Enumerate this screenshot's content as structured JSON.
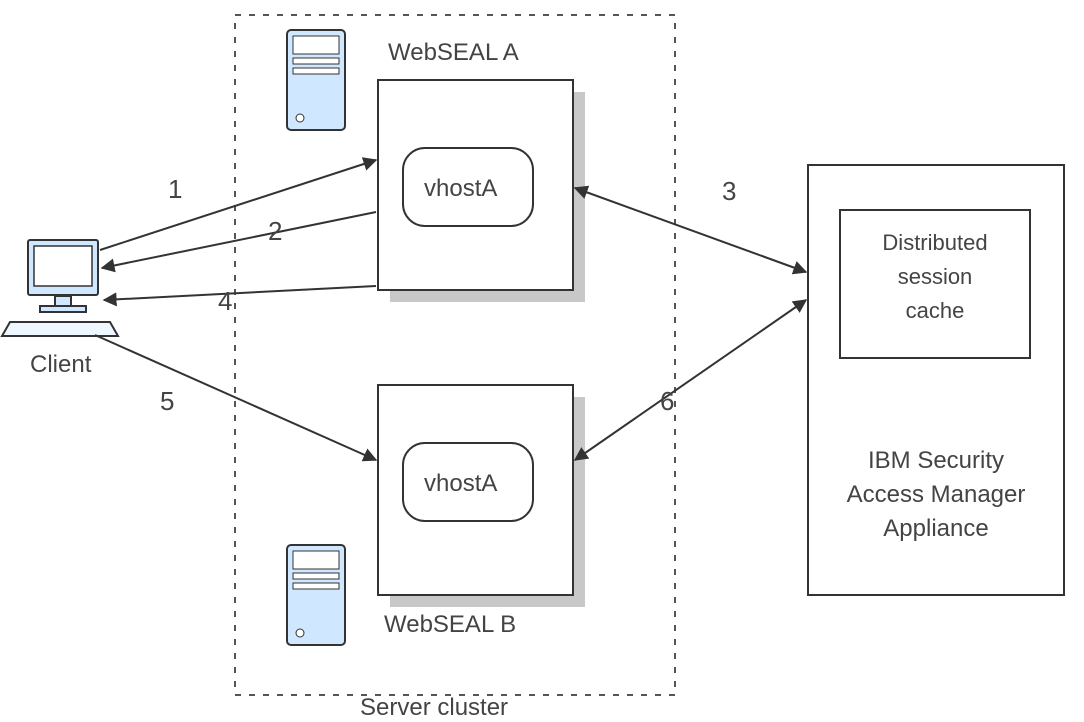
{
  "client_label": "Client",
  "cluster_label": "Server cluster",
  "webseal_a_label": "WebSEAL A",
  "webseal_b_label": "WebSEAL B",
  "vhost_a_label": "vhostA",
  "vhost_b_label": "vhostA",
  "appliance_label_line1": "IBM Security",
  "appliance_label_line2": "Access Manager",
  "appliance_label_line3": "Appliance",
  "cache_label_line1": "Distributed",
  "cache_label_line2": "session",
  "cache_label_line3": "cache",
  "step1": "1",
  "step2": "2",
  "step3": "3",
  "step4": "4",
  "step5": "5",
  "step6": "6"
}
